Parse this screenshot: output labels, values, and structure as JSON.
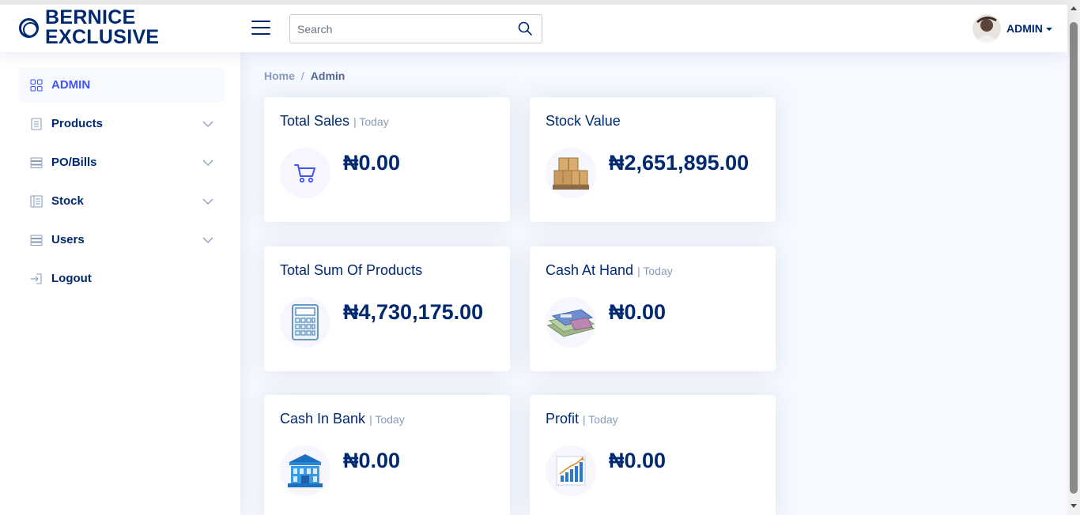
{
  "header": {
    "logo_line1": "BERNICE",
    "logo_line2": "EXCLUSIVE",
    "search_placeholder": "Search",
    "user_name": "ADMIN"
  },
  "sidebar": {
    "items": [
      {
        "label": "ADMIN",
        "icon": "grid-icon",
        "active": true
      },
      {
        "label": "Products",
        "icon": "document-icon"
      },
      {
        "label": "PO/Bills",
        "icon": "list-icon"
      },
      {
        "label": "Stock",
        "icon": "table-icon"
      },
      {
        "label": "Users",
        "icon": "list-icon"
      },
      {
        "label": "Logout",
        "icon": "logout-icon"
      }
    ]
  },
  "breadcrumb": {
    "home": "Home",
    "separator": "/",
    "current": "Admin"
  },
  "cards": [
    {
      "title": "Total Sales",
      "sub": "| Today",
      "value": "₦0.00",
      "icon": "cart-icon"
    },
    {
      "title": "Stock Value",
      "sub": "",
      "value": "₦2,651,895.00",
      "icon": "boxes-icon"
    },
    {
      "title": "Total Sum Of Products",
      "sub": "",
      "value": "₦4,730,175.00",
      "icon": "calculator-icon"
    },
    {
      "title": "Cash At Hand",
      "sub": "| Today",
      "value": "₦0.00",
      "icon": "cash-icon"
    },
    {
      "title": "Cash In Bank",
      "sub": "| Today",
      "value": "₦0.00",
      "icon": "bank-icon"
    },
    {
      "title": "Profit",
      "sub": "| Today",
      "value": "₦0.00",
      "icon": "profit-chart-icon"
    }
  ],
  "colors": {
    "primary": "#012970",
    "accent": "#4154f1",
    "muted": "#899bbd",
    "background": "#f6f9ff"
  }
}
